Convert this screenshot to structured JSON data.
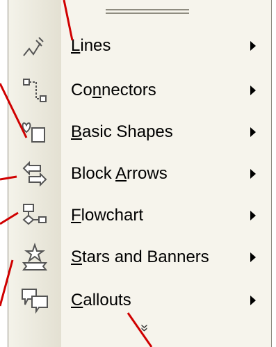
{
  "menu": {
    "items": [
      {
        "label": "Lines",
        "accel": "L",
        "rest": "ines",
        "icon": "lines-icon"
      },
      {
        "label": "Connectors",
        "accel": "n",
        "pre": "Co",
        "rest": "nectors",
        "icon": "connectors-icon"
      },
      {
        "label": "Basic Shapes",
        "accel": "B",
        "rest": "asic Shapes",
        "icon": "basic-shapes-icon"
      },
      {
        "label": "Block Arrows",
        "pre": "Block ",
        "accel": "A",
        "rest": "rrows",
        "icon": "block-arrows-icon"
      },
      {
        "label": "Flowchart",
        "accel": "F",
        "rest": "lowchart",
        "icon": "flowchart-icon"
      },
      {
        "label": "Stars and Banners",
        "accel": "S",
        "rest": "tars and Banners",
        "icon": "stars-banners-icon"
      },
      {
        "label": "Callouts",
        "accel": "C",
        "rest": "allouts",
        "icon": "callouts-icon"
      }
    ],
    "more_glyph": "»",
    "submenu_arrow": "submenu-arrow-icon"
  },
  "colors": {
    "menu_bg": "#f6f4ec",
    "gutter": "#e3e0d2",
    "annotation_lines": "#d00000"
  }
}
